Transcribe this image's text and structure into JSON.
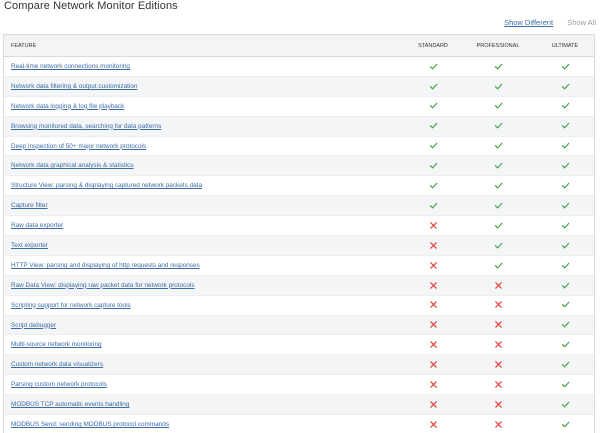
{
  "page": {
    "title": "Compare Network Monitor Editions",
    "show_different": "Show Different",
    "show_all": "Show All"
  },
  "table": {
    "headers": [
      "FEATURE",
      "STANDARD",
      "PROFESSIONAL",
      "ULTIMATE"
    ],
    "rows": [
      {
        "feature": "Real-time network connections monitoring",
        "standard": true,
        "professional": true,
        "ultimate": true
      },
      {
        "feature": "Network data filtering & output customization",
        "standard": true,
        "professional": true,
        "ultimate": true
      },
      {
        "feature": "Network data logging & log file playback",
        "standard": true,
        "professional": true,
        "ultimate": true
      },
      {
        "feature": "Browsing monitored data, searching for data patterns",
        "standard": true,
        "professional": true,
        "ultimate": true
      },
      {
        "feature": "Deep inspection of 50+ major network protocols",
        "standard": true,
        "professional": true,
        "ultimate": true
      },
      {
        "feature": "Network data graphical analysis & statistics",
        "standard": true,
        "professional": true,
        "ultimate": true
      },
      {
        "feature": "Structure View: parsing & displaying captured network packets data",
        "standard": true,
        "professional": true,
        "ultimate": true
      },
      {
        "feature": "Capture filter",
        "standard": true,
        "professional": true,
        "ultimate": true
      },
      {
        "feature": "Raw data exporter",
        "standard": false,
        "professional": true,
        "ultimate": true
      },
      {
        "feature": "Text exporter",
        "standard": false,
        "professional": true,
        "ultimate": true
      },
      {
        "feature": "HTTP View: parsing and displaying of http requests and responses",
        "standard": false,
        "professional": true,
        "ultimate": true
      },
      {
        "feature": "Raw Data View: displaying raw packet data for network protocols",
        "standard": false,
        "professional": false,
        "ultimate": true
      },
      {
        "feature": "Scripting support for network capture tools",
        "standard": false,
        "professional": false,
        "ultimate": true
      },
      {
        "feature": "Script debugger",
        "standard": false,
        "professional": false,
        "ultimate": true
      },
      {
        "feature": "Multi-source network monitoring",
        "standard": false,
        "professional": false,
        "ultimate": true
      },
      {
        "feature": "Custom network data visualizers",
        "standard": false,
        "professional": false,
        "ultimate": true
      },
      {
        "feature": "Parsing custom network protocols",
        "standard": false,
        "professional": false,
        "ultimate": true
      },
      {
        "feature": "MODBUS TCP automatic events handling",
        "standard": false,
        "professional": false,
        "ultimate": true
      },
      {
        "feature": "MODBUS Send: sending MODBUS protocol commands",
        "standard": false,
        "professional": false,
        "ultimate": true
      }
    ]
  },
  "icons": {
    "yes": "check-icon",
    "no": "cross-icon"
  },
  "colors": {
    "check": "#43a047",
    "cross": "#e0403a",
    "link": "#3b6ba5"
  }
}
